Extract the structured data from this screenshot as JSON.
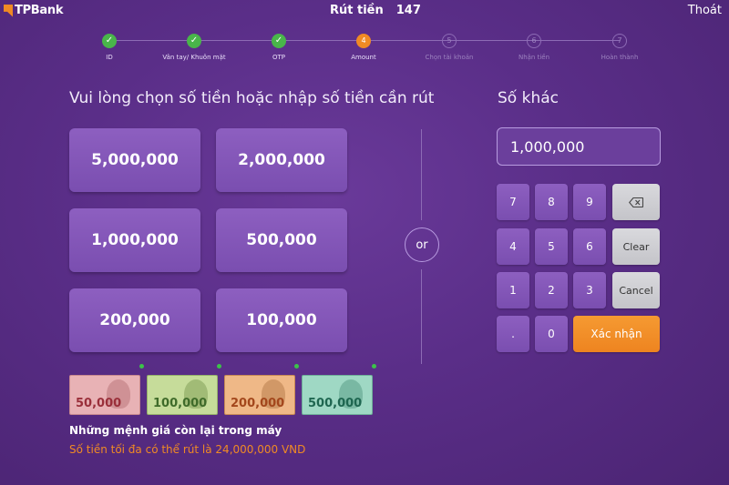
{
  "header": {
    "logo": "TPBank",
    "title": "Rút tiền",
    "number": "147",
    "exit_label": "Thoát"
  },
  "steps": [
    {
      "mark": "✓",
      "label": "ID",
      "state": "done"
    },
    {
      "mark": "✓",
      "label": "Vân tay/ Khuôn mặt",
      "state": "done"
    },
    {
      "mark": "✓",
      "label": "OTP",
      "state": "done"
    },
    {
      "mark": "4",
      "label": "Amount",
      "state": "active"
    },
    {
      "mark": "5",
      "label": "Chọn tài khoản",
      "state": "todo"
    },
    {
      "mark": "6",
      "label": "Nhận tiền",
      "state": "todo"
    },
    {
      "mark": "7",
      "label": "Hoàn thành",
      "state": "todo"
    }
  ],
  "main": {
    "prompt": "Vui lòng chọn số tiền hoặc nhập số tiền cần rút",
    "amounts": [
      "5,000,000",
      "2,000,000",
      "1,000,000",
      "500,000",
      "200,000",
      "100,000"
    ],
    "notes": [
      {
        "value": "50,000",
        "color": "#e2a2a6"
      },
      {
        "value": "100,000",
        "color": "#b8d48a"
      },
      {
        "value": "200,000",
        "color": "#e9a872"
      },
      {
        "value": "500,000",
        "color": "#8ecfb8"
      }
    ],
    "remaining_label": "Những mệnh giá còn lại trong máy",
    "max_label": "Số tiền tối đa có thể rút là 24,000,000 VND"
  },
  "or_label": "or",
  "other": {
    "label": "Số khác",
    "input_value": "1,000,000",
    "keys": [
      "7",
      "8",
      "9",
      "4",
      "5",
      "6",
      "1",
      "2",
      "3",
      ".",
      "0"
    ],
    "backspace_icon": "backspace-icon",
    "clear_label": "Clear",
    "cancel_label": "Cancel",
    "confirm_label": "Xác nhận"
  },
  "colors": {
    "accent": "#f08a24",
    "done": "#49b54a",
    "background": "#5a2e88"
  }
}
